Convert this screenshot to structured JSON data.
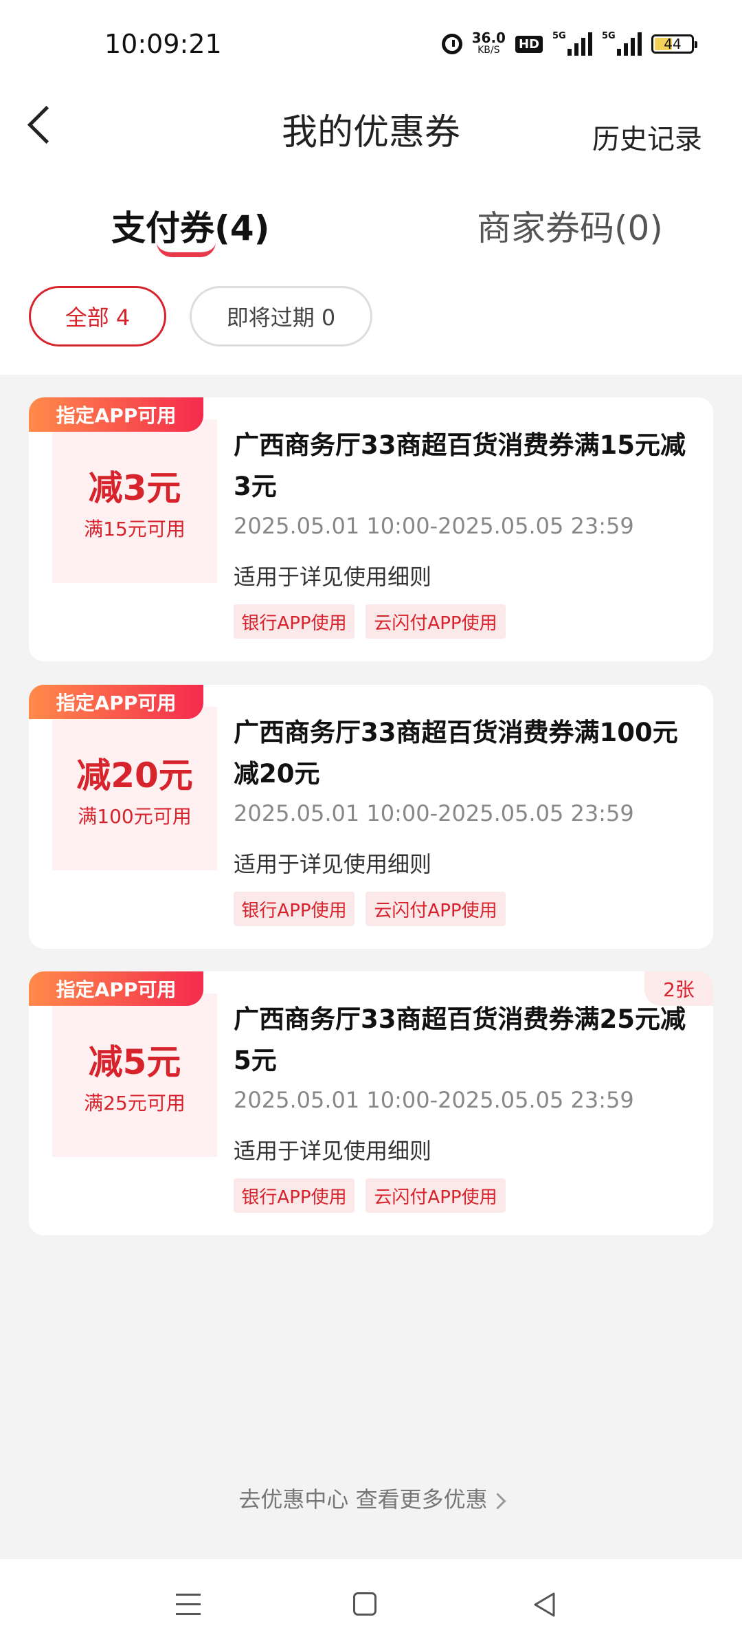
{
  "status_bar": {
    "time": "10:09:21",
    "net_speed_value": "36.0",
    "net_speed_unit": "KB/S",
    "hd_label": "HD",
    "signal_label": "5G",
    "battery": "44"
  },
  "header": {
    "title": "我的优惠券",
    "history": "历史记录"
  },
  "tabs": [
    {
      "label": "支付券(4)"
    },
    {
      "label": "商家券码(0)"
    }
  ],
  "filters": [
    {
      "label": "全部 4"
    },
    {
      "label": "即将过期 0"
    }
  ],
  "coupons": [
    {
      "badge": "指定APP可用",
      "discount": "减3元",
      "threshold": "满15元可用",
      "title": "广西商务厅33商超百货消费券满15元减3元",
      "date": "2025.05.01 10:00-2025.05.05 23:59",
      "scope": "适用于详见使用细则",
      "tags": [
        "银行APP使用",
        "云闪付APP使用"
      ],
      "count": ""
    },
    {
      "badge": "指定APP可用",
      "discount": "减20元",
      "threshold": "满100元可用",
      "title": "广西商务厅33商超百货消费券满100元减20元",
      "date": "2025.05.01 10:00-2025.05.05 23:59",
      "scope": "适用于详见使用细则",
      "tags": [
        "银行APP使用",
        "云闪付APP使用"
      ],
      "count": ""
    },
    {
      "badge": "指定APP可用",
      "discount": "减5元",
      "threshold": "满25元可用",
      "title": "广西商务厅33商超百货消费券满25元减5元",
      "date": "2025.05.01 10:00-2025.05.05 23:59",
      "scope": "适用于详见使用细则",
      "tags": [
        "银行APP使用",
        "云闪付APP使用"
      ],
      "count": "2张"
    }
  ],
  "footer_link": "去优惠中心 查看更多优惠"
}
